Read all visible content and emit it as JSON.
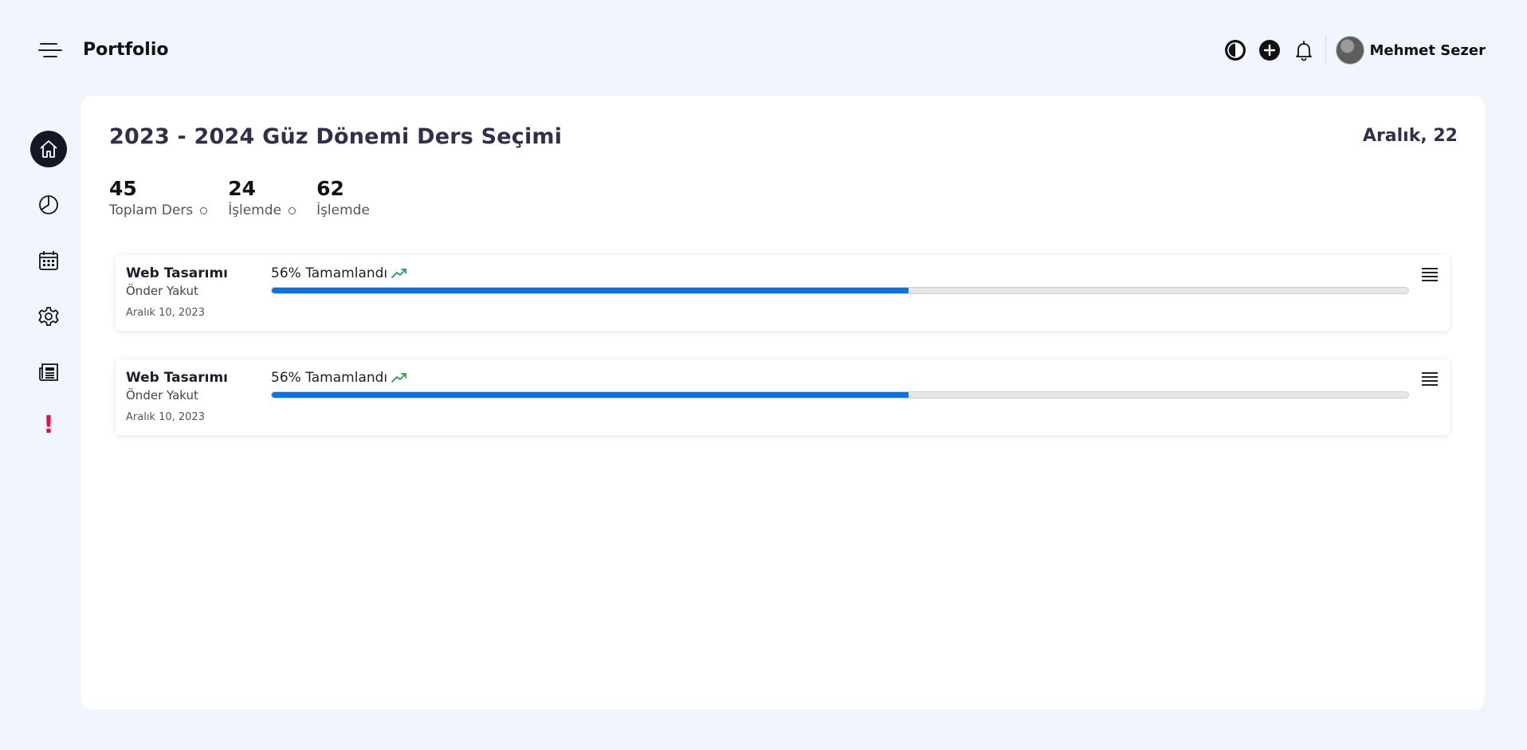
{
  "app": {
    "title": "Portfolio"
  },
  "user": {
    "name": "Mehmet Sezer"
  },
  "topbar": {
    "icons": [
      "theme-toggle-icon",
      "add-icon",
      "bell-icon"
    ]
  },
  "sidebar": {
    "items": [
      {
        "icon": "home-icon",
        "active": true
      },
      {
        "icon": "pie-chart-icon",
        "active": false
      },
      {
        "icon": "calendar-icon",
        "active": false
      },
      {
        "icon": "settings-icon",
        "active": false
      },
      {
        "icon": "newspaper-icon",
        "active": false
      }
    ],
    "alert": "!"
  },
  "page": {
    "title": "2023 - 2024 Güz Dönemi Ders Seçimi",
    "date": "Aralık, 22"
  },
  "stats": [
    {
      "value": "45",
      "label": "Toplam Ders"
    },
    {
      "value": "24",
      "label": "İşlemde"
    },
    {
      "value": "62",
      "label": "İşlemde"
    }
  ],
  "courses": [
    {
      "name": "Web Tasarımı",
      "teacher": "Önder Yakut",
      "date": "Aralık 10, 2023",
      "progress_label": "56% Tamamlandı",
      "progress": 0.56
    },
    {
      "name": "Web Tasarımı",
      "teacher": "Önder Yakut",
      "date": "Aralık 10, 2023",
      "progress_label": "56% Tamamlandı",
      "progress": 0.56
    }
  ],
  "colors": {
    "background": "#f1f5fd",
    "accent": "#0a73e6",
    "trend": "#16a34a",
    "alert": "#e0133d",
    "active_nav": "#161726"
  }
}
